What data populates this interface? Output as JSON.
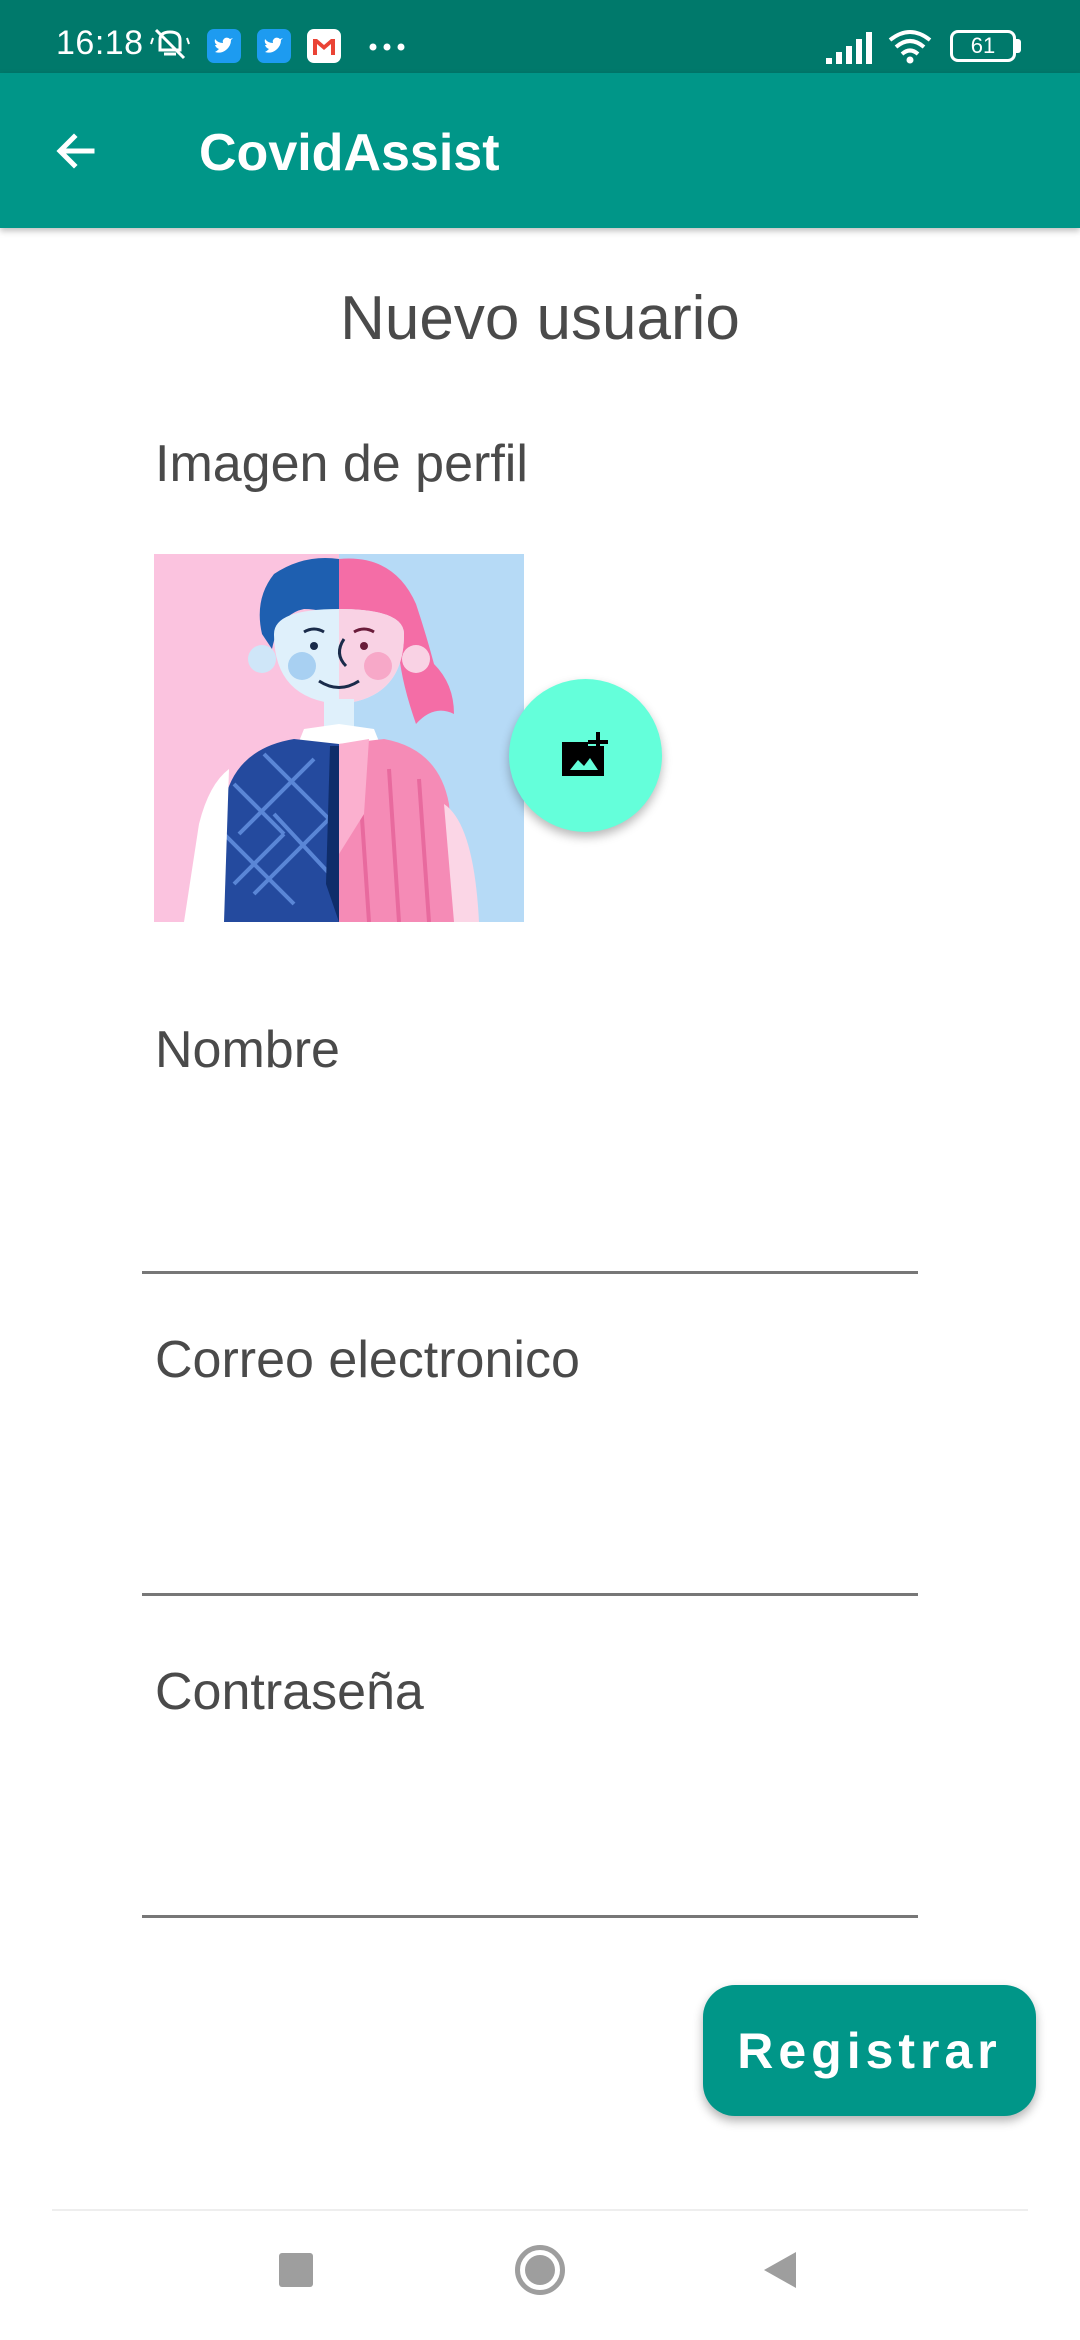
{
  "status_bar": {
    "time": "16:18",
    "battery": "61",
    "icons": [
      "vibrate-mute-icon",
      "twitter-icon",
      "twitter-icon",
      "gmail-icon",
      "more-icon",
      "signal-icon",
      "wifi-icon",
      "battery-icon"
    ]
  },
  "app_bar": {
    "title": "CovidAssist",
    "back_icon": "arrow-back-icon"
  },
  "form": {
    "title": "Nuevo usuario",
    "profile_image_label": "Imagen de perfil",
    "add_photo_icon": "add-photo-icon",
    "name_label": "Nombre",
    "name_value": "",
    "email_label": "Correo electronico",
    "email_value": "",
    "password_label": "Contraseña",
    "password_value": ""
  },
  "actions": {
    "register_label": "Registrar"
  },
  "nav_bar": {
    "icons": [
      "recents-square-icon",
      "home-circle-icon",
      "back-triangle-icon"
    ]
  },
  "colors": {
    "status_bar": "#00796b",
    "primary": "#009688",
    "accent": "#64ffda",
    "text": "#4a4a4a"
  }
}
